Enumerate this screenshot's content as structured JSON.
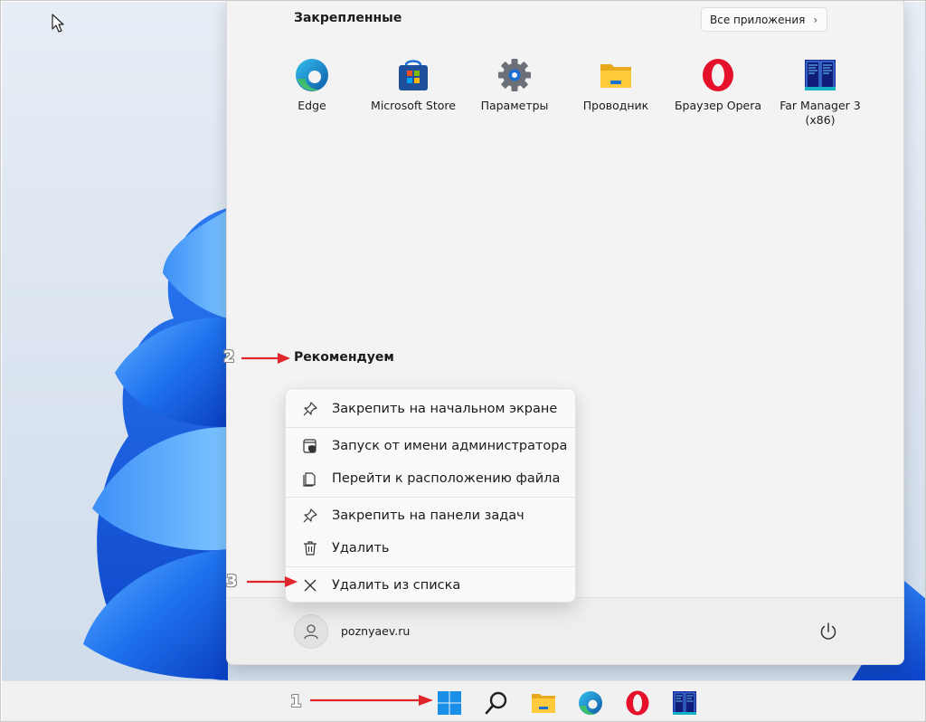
{
  "start_menu": {
    "pinned_title": "Закрепленные",
    "all_apps_label": "Все приложения",
    "recommended_title": "Рекомендуем",
    "pinned_apps": [
      {
        "label": "Edge",
        "icon": "edge-icon"
      },
      {
        "label": "Microsoft Store",
        "icon": "microsoft-store-icon"
      },
      {
        "label": "Параметры",
        "icon": "settings-gear-icon"
      },
      {
        "label": "Проводник",
        "icon": "folder-icon"
      },
      {
        "label": "Браузер Opera",
        "icon": "opera-icon"
      },
      {
        "label": "Far Manager 3 (x86)",
        "icon": "far-manager-icon"
      }
    ],
    "footer": {
      "username": "poznyaev.ru",
      "avatar_icon": "user-icon",
      "power_icon": "power-icon"
    }
  },
  "context_menu": {
    "items": [
      {
        "label": "Закрепить на начальном экране",
        "icon": "pin-icon"
      },
      {
        "label": "Запуск от имени администратора",
        "icon": "shield-admin-icon"
      },
      {
        "label": "Перейти к расположению файла",
        "icon": "file-location-icon"
      },
      {
        "label": "Закрепить на панели задач",
        "icon": "pin-icon"
      },
      {
        "label": "Удалить",
        "icon": "trash-icon"
      },
      {
        "label": "Удалить из списка",
        "icon": "close-icon"
      }
    ]
  },
  "taskbar": {
    "items": [
      {
        "icon": "windows-start-icon"
      },
      {
        "icon": "search-icon"
      },
      {
        "icon": "folder-icon"
      },
      {
        "icon": "edge-icon"
      },
      {
        "icon": "opera-icon"
      },
      {
        "icon": "far-manager-icon"
      }
    ]
  },
  "annotations": [
    {
      "number": "1"
    },
    {
      "number": "2"
    },
    {
      "number": "3"
    }
  ],
  "colors": {
    "annotation_arrow": "#e0262b",
    "windows_blue": "#1a73e8",
    "menu_bg": "#f3f3f3"
  }
}
